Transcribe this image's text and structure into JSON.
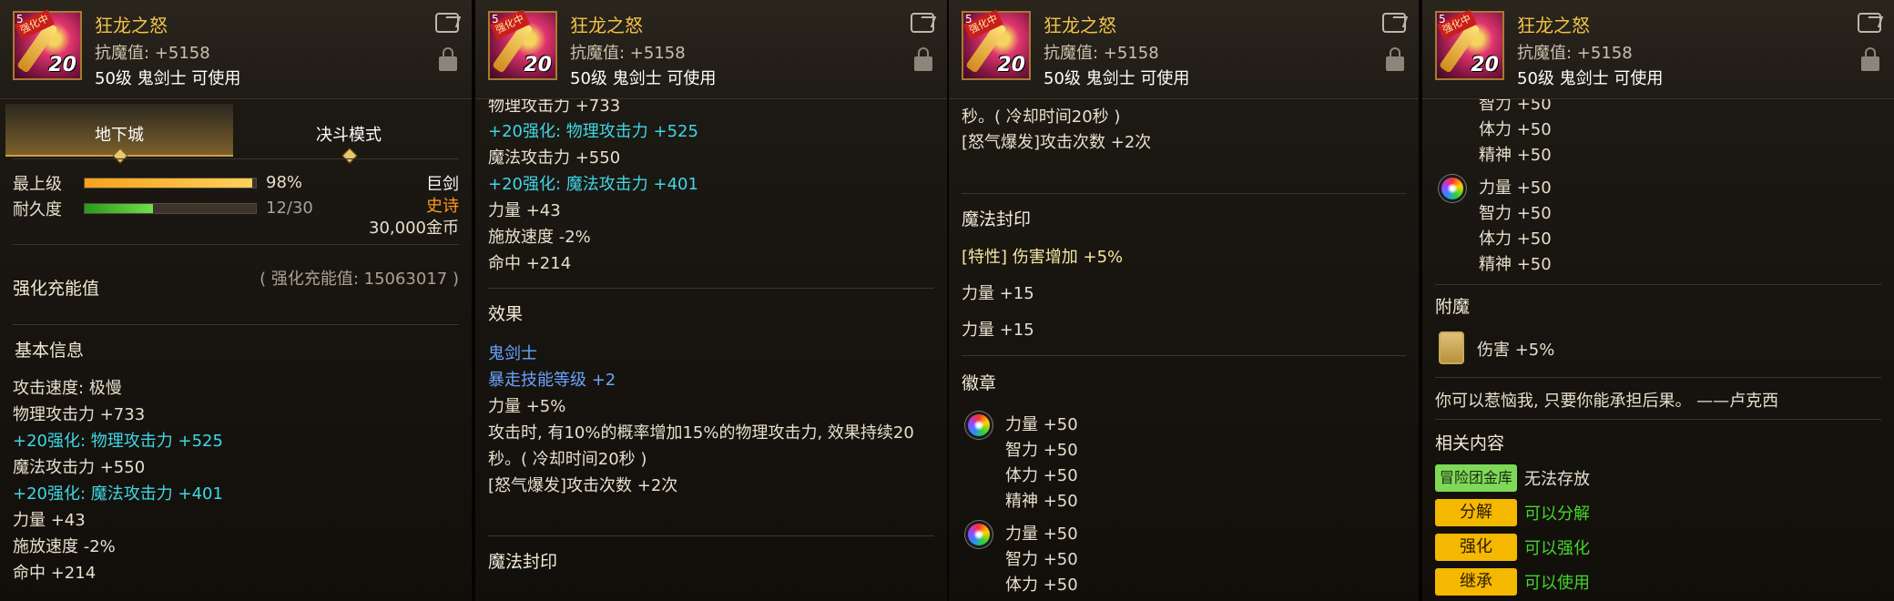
{
  "item": {
    "title": "狂龙之怒",
    "stat": "抗魔值: +5158",
    "requirement": "50级 鬼剑士 可使用",
    "icon_badge": "强化中",
    "icon_level": "20",
    "icon_corner": "5"
  },
  "panel1": {
    "tabs": [
      "地下城",
      "决斗模式"
    ],
    "grade_label": "最上级",
    "grade_pct": "98%",
    "grade_fraction": 0.98,
    "durability_label": "耐久度",
    "durability_value": "12/30",
    "durability_fraction": 0.4,
    "weapon_type": "巨剑",
    "rarity": "史诗",
    "price": "30,000金币",
    "charge_label": "强化充能值",
    "charge_value": "( 强化充能值: 15063017 )",
    "basic_info": "基本信息",
    "lines": [
      {
        "text": "攻击速度: 极慢",
        "style": "white"
      },
      {
        "text": "物理攻击力 +733",
        "style": "white"
      },
      {
        "text": "+20强化: 物理攻击力 +525",
        "style": "cyan"
      },
      {
        "text": "魔法攻击力 +550",
        "style": "white"
      },
      {
        "text": "+20强化: 魔法攻击力 +401",
        "style": "cyan"
      },
      {
        "text": "力量 +43",
        "style": "white"
      },
      {
        "text": "施放速度 -2%",
        "style": "white"
      },
      {
        "text": "命中 +214",
        "style": "white"
      }
    ]
  },
  "panel2": {
    "top_partial": "物理攻击力 +733",
    "lines": [
      {
        "text": "+20强化: 物理攻击力 +525",
        "style": "cyan"
      },
      {
        "text": "魔法攻击力 +550",
        "style": "white"
      },
      {
        "text": "+20强化: 魔法攻击力 +401",
        "style": "cyan"
      },
      {
        "text": "力量 +43",
        "style": "white"
      },
      {
        "text": "施放速度 -2%",
        "style": "white"
      },
      {
        "text": "命中 +214",
        "style": "white"
      }
    ],
    "effect_title": "效果",
    "effect_lines": [
      {
        "text": "鬼剑士",
        "style": "blue"
      },
      {
        "text": "暴走技能等级 +2",
        "style": "blue"
      },
      {
        "text": "力量 +5%",
        "style": "white"
      },
      {
        "text": "攻击时, 有10%的概率增加15%的物理攻击力, 效果持续20",
        "style": "white"
      },
      {
        "text": "秒。( 冷却时间20秒 )",
        "style": "white"
      },
      {
        "text": "[怒气爆发]攻击次数 +2次",
        "style": "white"
      }
    ],
    "magic_seal_title": "魔法封印"
  },
  "panel3": {
    "lines_top": [
      "秒。( 冷却时间20秒 )",
      "[怒气爆发]攻击次数 +2次"
    ],
    "magic_seal_title": "魔法封印",
    "seal_trait": "[特性] 伤害增加 +5%",
    "seal_lines": [
      "力量 +15",
      "力量 +15"
    ],
    "emblem_title": "徽章",
    "emblem1": [
      "力量 +50",
      "智力 +50",
      "体力 +50",
      "精神 +50"
    ],
    "emblem2": [
      "力量 +50",
      "智力 +50",
      "体力 +50"
    ]
  },
  "panel4": {
    "emblem_top": [
      "智力 +50",
      "体力 +50",
      "精神 +50"
    ],
    "emblem2": [
      "力量 +50",
      "智力 +50",
      "体力 +50",
      "精神 +50"
    ],
    "enchant_title": "附魔",
    "enchant_value": "伤害 +5%",
    "flavor": "你可以惹恼我, 只要你能承担后果。 ——卢克西",
    "related_title": "相关内容",
    "related": [
      {
        "button": "冒险团金库",
        "status": "无法存放",
        "button_style": "g",
        "status_style": "white"
      },
      {
        "button": "分解",
        "status": "可以分解",
        "button_style": "y",
        "status_style": "green"
      },
      {
        "button": "强化",
        "status": "可以强化",
        "button_style": "y",
        "status_style": "green"
      },
      {
        "button": "继承",
        "status": "可以使用",
        "button_style": "y",
        "status_style": "green"
      }
    ]
  }
}
